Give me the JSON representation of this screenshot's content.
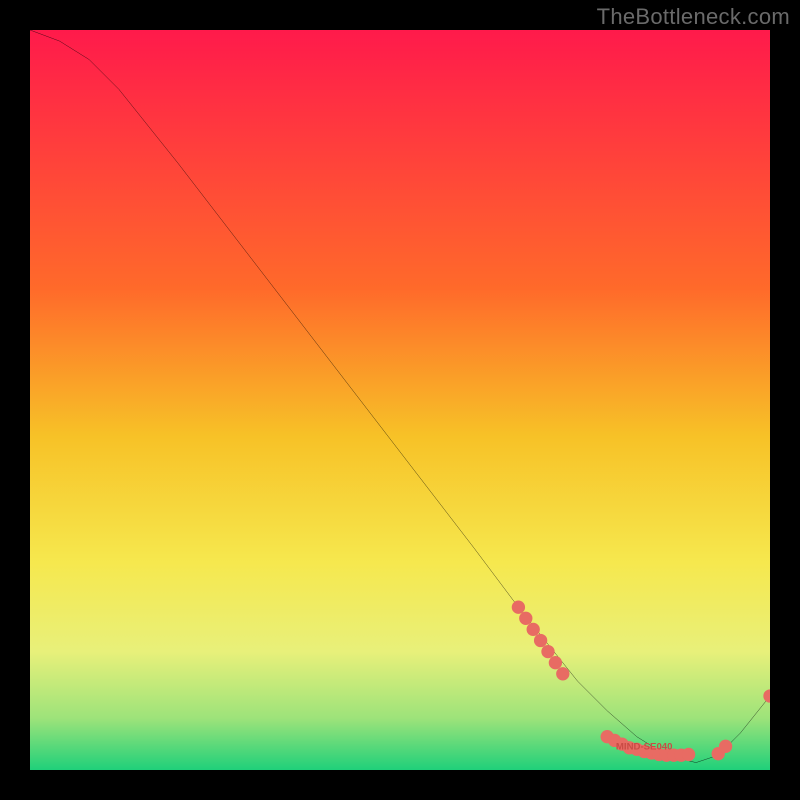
{
  "watermark": "TheBottleneck.com",
  "chart_data": {
    "type": "line",
    "title": "",
    "xlabel": "",
    "ylabel": "",
    "xlim": [
      0,
      100
    ],
    "ylim": [
      0,
      100
    ],
    "grid": false,
    "legend": false,
    "gradient_stops": [
      {
        "offset": 0,
        "color": "#ff1a4b"
      },
      {
        "offset": 35,
        "color": "#ff6a2a"
      },
      {
        "offset": 55,
        "color": "#f7c227"
      },
      {
        "offset": 72,
        "color": "#f6e84e"
      },
      {
        "offset": 84,
        "color": "#e8f07a"
      },
      {
        "offset": 93,
        "color": "#9de37a"
      },
      {
        "offset": 100,
        "color": "#1fd07a"
      }
    ],
    "series": [
      {
        "name": "bottleneck-curve",
        "color": "#000000",
        "x": [
          0,
          4,
          8,
          12,
          20,
          30,
          40,
          50,
          60,
          66,
          70,
          74,
          78,
          82,
          86,
          90,
          93,
          96,
          100
        ],
        "y": [
          100,
          98.5,
          96,
          92,
          82,
          69,
          56,
          43,
          30,
          22,
          17,
          12,
          8,
          4.5,
          2,
          1,
          2,
          5,
          10
        ]
      }
    ],
    "points": [
      {
        "name": "cluster-upper",
        "color": "#e86b63",
        "x": [
          66,
          67,
          68,
          69,
          70,
          71,
          72
        ],
        "y": [
          22,
          20.5,
          19,
          17.5,
          16,
          14.5,
          13
        ]
      },
      {
        "name": "cluster-lower",
        "color": "#e86b63",
        "x": [
          78,
          79,
          80,
          81,
          82,
          83,
          84,
          85,
          86,
          87,
          88,
          89
        ],
        "y": [
          4.5,
          4,
          3.5,
          3,
          2.8,
          2.5,
          2.3,
          2.1,
          2,
          2,
          2,
          2.1
        ]
      },
      {
        "name": "cluster-right",
        "color": "#e86b63",
        "x": [
          93,
          94,
          100
        ],
        "y": [
          2.2,
          3.2,
          10
        ]
      }
    ],
    "mini_label": {
      "text": "MIND-SE040",
      "x": 83,
      "y": 2.8,
      "color": "#c94c45"
    }
  }
}
